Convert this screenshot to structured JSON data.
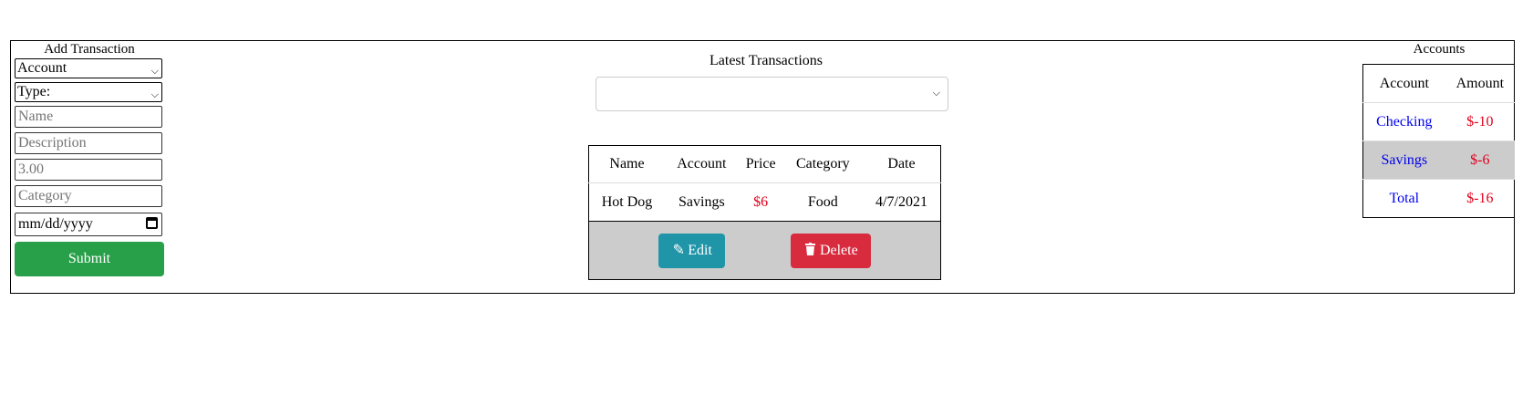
{
  "add_transaction": {
    "title": "Add Transaction",
    "account_select": "Account",
    "type_select": "Type:",
    "name_placeholder": "Name",
    "description_placeholder": "Description",
    "amount_value": "3.00",
    "category_placeholder": "Category",
    "date_placeholder": "mm/dd/yyyy",
    "submit_label": "Submit"
  },
  "latest": {
    "title": "Latest Transactions",
    "filter_value": "",
    "columns": [
      "Name",
      "Account",
      "Price",
      "Category",
      "Date"
    ],
    "rows": [
      {
        "name": "Hot Dog",
        "account": "Savings",
        "price": "$6",
        "category": "Food",
        "date": "4/7/2021"
      }
    ],
    "edit_label": "Edit",
    "delete_label": "Delete"
  },
  "accounts": {
    "title": "Accounts",
    "columns": [
      "Account",
      "Amount"
    ],
    "rows": [
      {
        "account": "Checking",
        "amount": "$-10"
      },
      {
        "account": "Savings",
        "amount": "$-6"
      },
      {
        "account": "Total",
        "amount": "$-16"
      }
    ]
  },
  "colors": {
    "submit": "#28a049",
    "edit": "#2195a8",
    "delete": "#d92b3e",
    "negative": "#e0001b",
    "link": "#0000ee",
    "highlight": "#cccccc"
  },
  "icons": {
    "edit": "edit-icon",
    "delete": "trash-icon",
    "calendar": "calendar-icon",
    "dropdown": "chevron-down-icon"
  }
}
